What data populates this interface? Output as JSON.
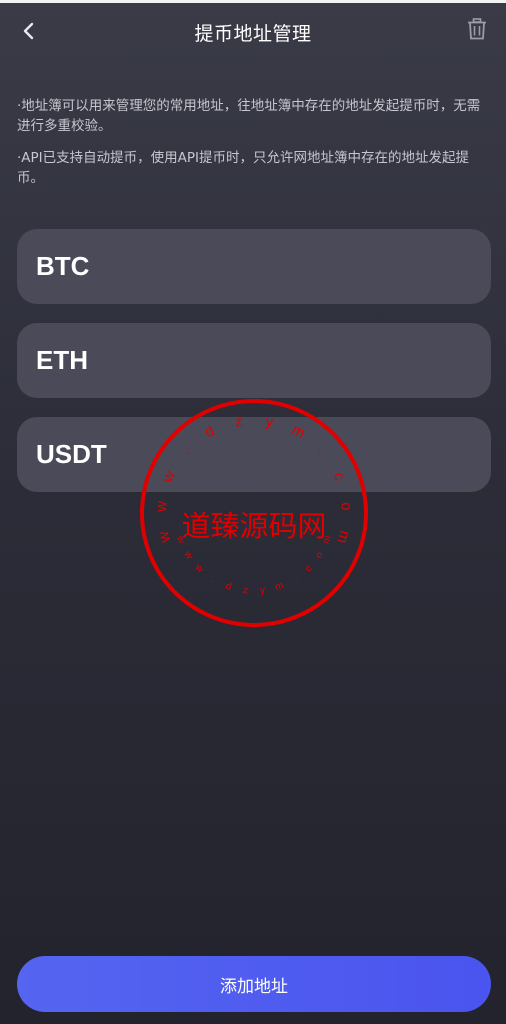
{
  "header": {
    "title": "提币地址管理",
    "back_icon": "chevron-left-icon",
    "trash_icon": "trash-icon"
  },
  "notes": [
    "·地址簿可以用来管理您的常用地址，往地址簿中存在的地址发起提币时，无需进行多重校验。",
    "·API已支持自动提币，使用API提币时，只允许网地址簿中存在的地址发起提币。"
  ],
  "coins": [
    "BTC",
    "ETH",
    "USDT"
  ],
  "add_button": {
    "label": "添加地址"
  },
  "watermark": {
    "center_text": "道臻源码网",
    "ring_text": "www.dzym.com",
    "color": "#e00000"
  },
  "colors": {
    "accent": "#4f5bef",
    "card": "#4a4a58"
  }
}
